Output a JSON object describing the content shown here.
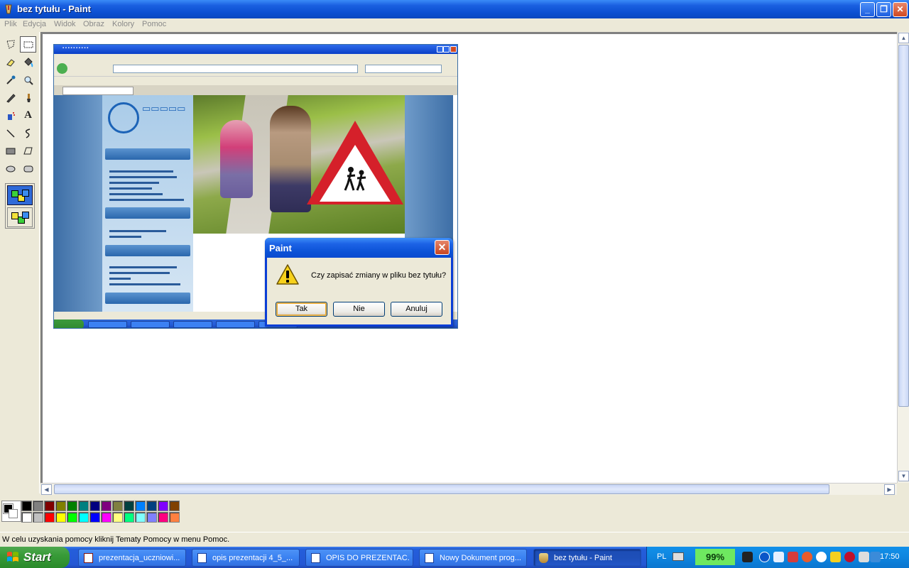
{
  "window": {
    "title": "bez tytułu - Paint",
    "buttons": {
      "minimize": "_",
      "maximize": "❐",
      "close": "✕"
    }
  },
  "menu": [
    "Plik",
    "Edycja",
    "Widok",
    "Obraz",
    "Kolory",
    "Pomoc"
  ],
  "tools": [
    "free-form-select",
    "rectangle-select",
    "eraser",
    "fill-bucket",
    "color-picker",
    "magnifier",
    "pencil",
    "brush",
    "airbrush",
    "text",
    "line",
    "curve",
    "rectangle",
    "polygon",
    "ellipse",
    "rounded-rectangle"
  ],
  "dialog": {
    "title": "Paint",
    "close": "✕",
    "message": "Czy zapisać zmiany w pliku bez tytułu?",
    "buttons": {
      "yes": "Tak",
      "no": "Nie",
      "cancel": "Anuluj"
    }
  },
  "palette": {
    "foreground": "#000000",
    "background": "#ffffff",
    "row1": [
      "#000000",
      "#808080",
      "#800000",
      "#808000",
      "#008000",
      "#008080",
      "#000080",
      "#800080",
      "#808040",
      "#004040",
      "#0080ff",
      "#004080",
      "#8000ff",
      "#804000"
    ],
    "row2": [
      "#ffffff",
      "#c0c0c0",
      "#ff0000",
      "#ffff00",
      "#00ff00",
      "#00ffff",
      "#0000ff",
      "#ff00ff",
      "#ffff80",
      "#00ff80",
      "#80ffff",
      "#8080ff",
      "#ff0080",
      "#ff8040"
    ]
  },
  "statusbar": {
    "message": "W celu uzyskania pomocy kliknij Tematy Pomocy w menu Pomoc."
  },
  "taskbar": {
    "start": "Start",
    "tasks": [
      {
        "label": "prezentacja_uczniowi...",
        "icon": "pdf-icon"
      },
      {
        "label": "opis prezentacji 4_5_...",
        "icon": "word-icon"
      },
      {
        "label": "OPIS DO PREZENTAC...",
        "icon": "word-icon"
      },
      {
        "label": "Nowy Dokument prog...",
        "icon": "word-icon"
      },
      {
        "label": "bez tytułu - Paint",
        "icon": "paint-icon",
        "active": true
      }
    ],
    "tray": {
      "language": "PL",
      "battery": "99%",
      "clock": "17:50"
    }
  }
}
